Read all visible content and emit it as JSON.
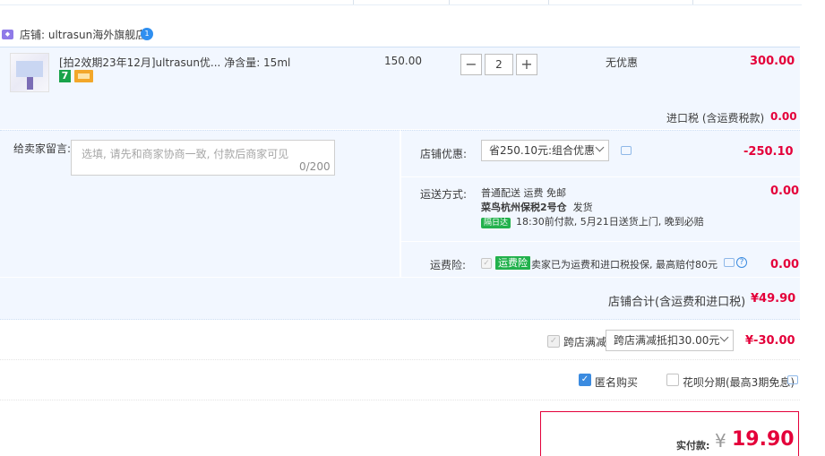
{
  "shop": {
    "label": "店铺: ultrasun海外旗舰店",
    "icon": "shop-icon",
    "badge": "1"
  },
  "item": {
    "title": "[拍2效期23年12月]ultrasun优...  净含量: 15ml",
    "tag_seven": "7",
    "price": "150.00",
    "quantity": "2",
    "minus": "−",
    "plus": "+",
    "discount_text": "无优惠",
    "subtotal": "300.00"
  },
  "tax": {
    "label": "进口税 (含运费税款)",
    "value": "0.00"
  },
  "message": {
    "label": "给卖家留言:",
    "placeholder": "选填, 请先和商家协商一致, 付款后商家可见",
    "count": "0/200"
  },
  "store_discount": {
    "label": "店铺优惠:",
    "selected": "省250.10元:组合优惠",
    "value": "-250.10"
  },
  "shipping": {
    "label": "运送方式:",
    "method": "普通配送 运费 免邮",
    "warehouse": "菜鸟杭州保税2号仓",
    "ship_note": "发货",
    "fast_badge": "隔日达",
    "eta": "18:30前付款, 5月21日送货上门, 晚到必赔",
    "value": "0.00"
  },
  "insurance": {
    "label": "运费险:",
    "badge": "运费险",
    "text": "卖家已为运费和进口税投保, 最高赔付80元",
    "help": "?",
    "value": "0.00"
  },
  "store_total": {
    "label": "店铺合计(含运费和进口税)",
    "value": "¥49.90"
  },
  "cross_store": {
    "label": "跨店满减",
    "selected": "跨店满减抵扣30.00元",
    "value": "¥-30.00"
  },
  "options": {
    "anonymous": "匿名购买",
    "anonymous_checked": true,
    "huabei": "花呗分期(最高3期免息)",
    "huabei_checked": false
  },
  "payment": {
    "label": "实付款:",
    "currency": "¥",
    "value": "19.90"
  },
  "colors": {
    "accent_red": "#e4003a",
    "panel_blue": "#f2f7ff",
    "check_blue": "#3b8be0",
    "badge_green": "#22b14c"
  }
}
